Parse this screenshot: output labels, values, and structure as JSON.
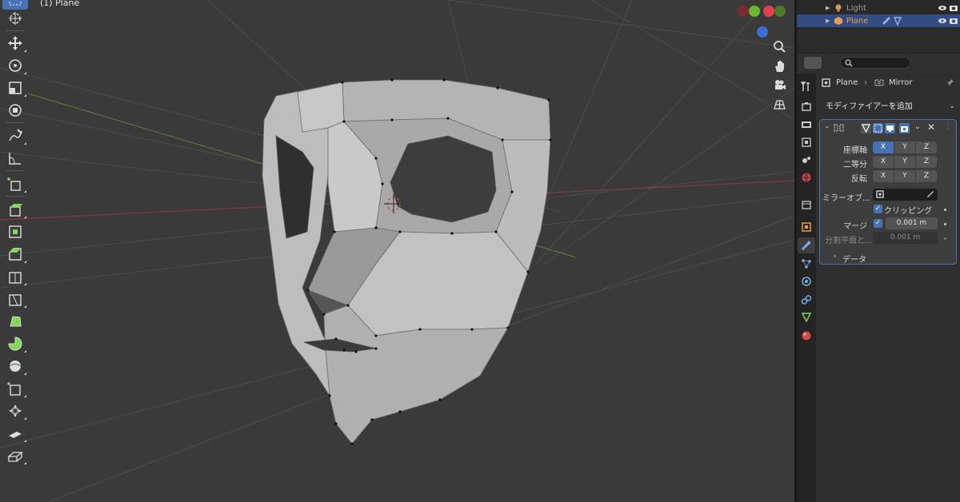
{
  "viewport": {
    "object_info": "(1) Plane",
    "toolbar_icons": [
      "select-box-icon",
      "cursor-icon",
      "move-icon",
      "rotate-icon",
      "scale-icon",
      "transform-icon",
      "annotate-icon",
      "measure-icon",
      "add-cube-icon",
      "extrude-icon",
      "inset-icon",
      "bevel-icon",
      "loop-cut-icon",
      "knife-icon",
      "poly-build-icon",
      "spin-icon",
      "smooth-icon",
      "edge-slide-icon",
      "shrink-fatten-icon",
      "shear-icon",
      "rip-icon"
    ],
    "gizmo_colors": {
      "x": "#e04050",
      "y": "#6ab82e",
      "z": "#3b6fd0"
    },
    "nav_icons": [
      "zoom-icon",
      "hand-pan-icon",
      "camera-icon",
      "grid-ortho-icon"
    ]
  },
  "outliner": {
    "items": [
      {
        "name": "Light",
        "icon": "light-icon",
        "selected": false
      },
      {
        "name": "Plane",
        "icon": "mesh-icon",
        "selected": true
      }
    ]
  },
  "properties": {
    "breadcrumb": {
      "object": "Plane",
      "modifier": "Mirror"
    },
    "add_modifier": "モディファイアーを追加",
    "modifier": {
      "axis_label": "座標軸",
      "bisect_label": "二等分",
      "flip_label": "反転",
      "axes": [
        "X",
        "Y",
        "Z"
      ],
      "axis_on": [
        true,
        false,
        false
      ],
      "bisect_on": [
        false,
        false,
        false
      ],
      "flip_on": [
        false,
        false,
        false
      ],
      "mirror_object_label": "ミラーオブ...",
      "clipping_label": "クリッピング",
      "clipping_checked": true,
      "merge_label": "マージ",
      "merge_checked": true,
      "merge_value": "0.001 m",
      "bisect_distance_label": "分割平面と...",
      "bisect_distance_value": "0.001 m",
      "data_section_label": "データ"
    },
    "tab_icons": [
      "tool-icon",
      "render-icon",
      "output-icon",
      "view-layer-icon",
      "scene-icon",
      "world-icon",
      "collection-icon",
      "object-icon",
      "modifier-icon",
      "particles-icon",
      "physics-icon",
      "constraints-icon",
      "data-icon",
      "material-icon"
    ]
  }
}
